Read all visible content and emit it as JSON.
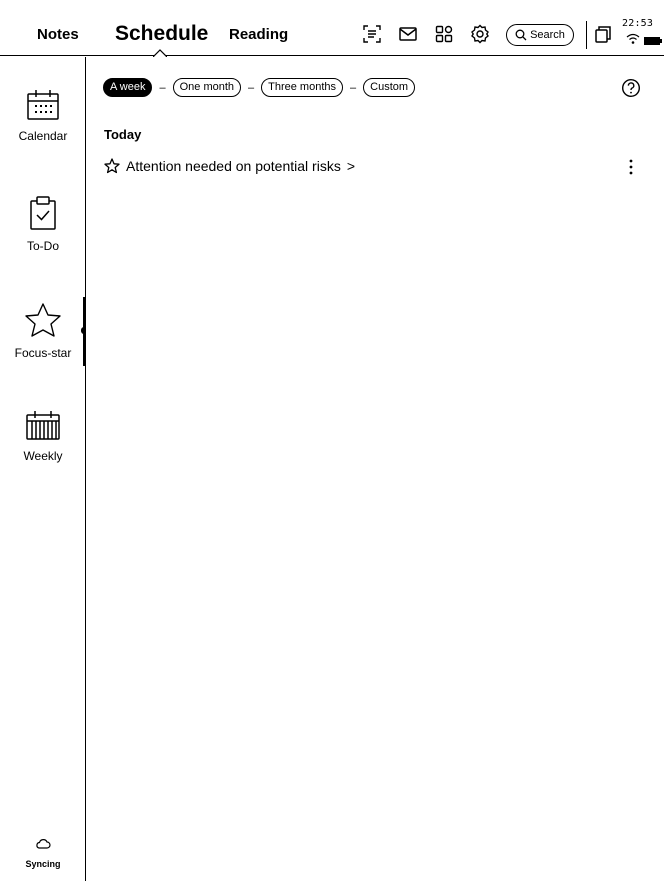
{
  "header": {
    "tabs": [
      {
        "label": "Notes"
      },
      {
        "label": "Schedule"
      },
      {
        "label": "Reading"
      }
    ],
    "active_tab": "Schedule",
    "toolbar": {
      "icons": [
        "scan-text-icon",
        "mail-icon",
        "apps-grid-icon",
        "settings-gear-icon"
      ],
      "search_label": "Search"
    },
    "status": {
      "time": "22:53",
      "icons": [
        "wifi-icon",
        "battery-icon"
      ]
    }
  },
  "sidebar": {
    "items": [
      {
        "label": "Calendar",
        "icon": "calendar-icon"
      },
      {
        "label": "To-Do",
        "icon": "todo-clipboard-icon"
      },
      {
        "label": "Focus-star",
        "icon": "star-icon"
      },
      {
        "label": "Weekly",
        "icon": "weekly-calendar-icon"
      }
    ],
    "active_item": "Focus-star",
    "sync": {
      "label": "Syncing",
      "icon": "cloud-icon"
    }
  },
  "main": {
    "filters": [
      {
        "label": "A week"
      },
      {
        "label": "One month"
      },
      {
        "label": "Three months"
      },
      {
        "label": "Custom"
      }
    ],
    "selected_filter": "A week",
    "filter_separator": "–",
    "help_icon": "help-circle-icon",
    "sections": [
      {
        "title": "Today",
        "items": [
          {
            "text": "Attention needed on potential risks",
            "suffix": ">",
            "icon": "star-outline-icon"
          }
        ]
      }
    ]
  },
  "colors": {
    "foreground": "#000000",
    "background": "#ffffff"
  }
}
